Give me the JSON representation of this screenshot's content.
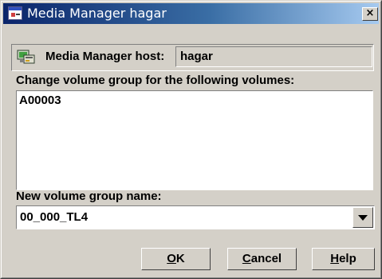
{
  "window": {
    "title": "Media Manager hagar",
    "close_glyph": "×"
  },
  "host": {
    "label": "Media Manager host:",
    "value": "hagar",
    "icon": "server-icon"
  },
  "volumes": {
    "label": "Change volume group for the following volumes:",
    "items": [
      "A00003"
    ]
  },
  "new_group": {
    "label": "New volume group name:",
    "value": "00_000_TL4"
  },
  "buttons": {
    "ok": {
      "mnemonic": "O",
      "rest": "K"
    },
    "cancel": {
      "mnemonic": "C",
      "rest": "ancel"
    },
    "help": {
      "mnemonic": "H",
      "rest": "elp"
    }
  },
  "colors": {
    "titlebar_start": "#0a246a",
    "titlebar_end": "#a6caf0",
    "dialog_bg": "#d4d0c8"
  }
}
